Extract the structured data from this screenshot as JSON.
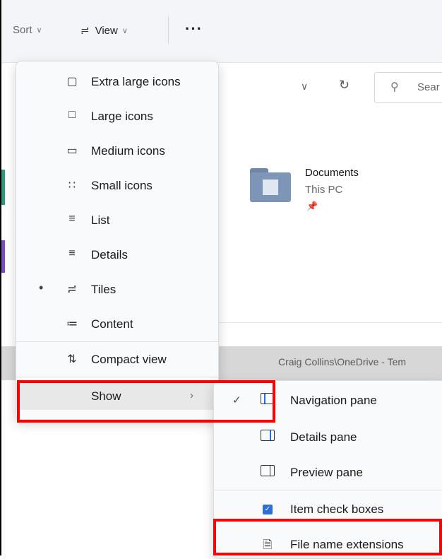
{
  "toolbar": {
    "sort_label": "Sort",
    "view_label": "View",
    "more_label": "···"
  },
  "address": {
    "search_placeholder": "Sear"
  },
  "content": {
    "item": {
      "title": "Documents",
      "subtitle": "This PC"
    },
    "path_text": "Craig Collins\\OneDrive - Tem"
  },
  "view_menu": {
    "items": [
      {
        "label": "Extra large icons",
        "icon": "extra-large-icons-icon"
      },
      {
        "label": "Large icons",
        "icon": "large-icons-icon"
      },
      {
        "label": "Medium icons",
        "icon": "medium-icons-icon"
      },
      {
        "label": "Small icons",
        "icon": "small-icons-icon"
      },
      {
        "label": "List",
        "icon": "list-icon"
      },
      {
        "label": "Details",
        "icon": "details-icon"
      },
      {
        "label": "Tiles",
        "icon": "tiles-icon",
        "selected": true
      },
      {
        "label": "Content",
        "icon": "content-icon"
      },
      {
        "label": "Compact view",
        "icon": "compact-view-icon"
      },
      {
        "label": "Show",
        "icon": ""
      }
    ]
  },
  "show_menu": {
    "items": [
      {
        "label": "Navigation pane",
        "checked": true
      },
      {
        "label": "Details pane"
      },
      {
        "label": "Preview pane"
      },
      {
        "label": "Item check boxes"
      },
      {
        "label": "File name extensions"
      }
    ]
  },
  "colors": {
    "highlight": "#ff0000",
    "accent": "#2a6fd6"
  }
}
